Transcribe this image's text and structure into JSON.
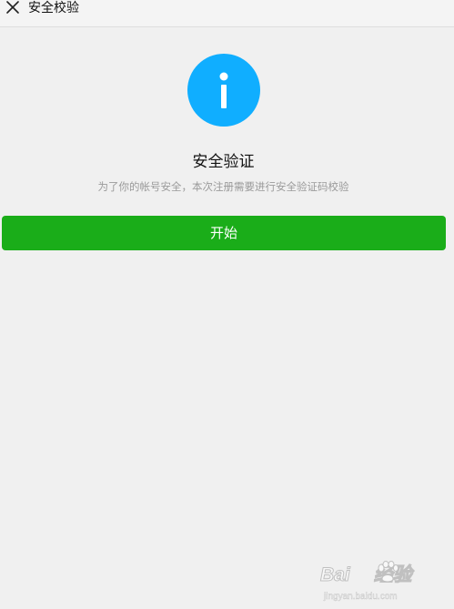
{
  "header": {
    "title": "安全校验",
    "close_icon": "close-icon"
  },
  "main": {
    "status_icon": "info-icon",
    "status_icon_color": "#10aeff",
    "heading": "安全验证",
    "description": "为了你的帐号安全，本次注册需要进行安全验证码校验",
    "start_button_label": "开始",
    "button_color": "#1aad19"
  },
  "watermark": {
    "logo_text": "Bai",
    "logo_suffix": "经验",
    "url": "jingyan.baidu.com"
  }
}
